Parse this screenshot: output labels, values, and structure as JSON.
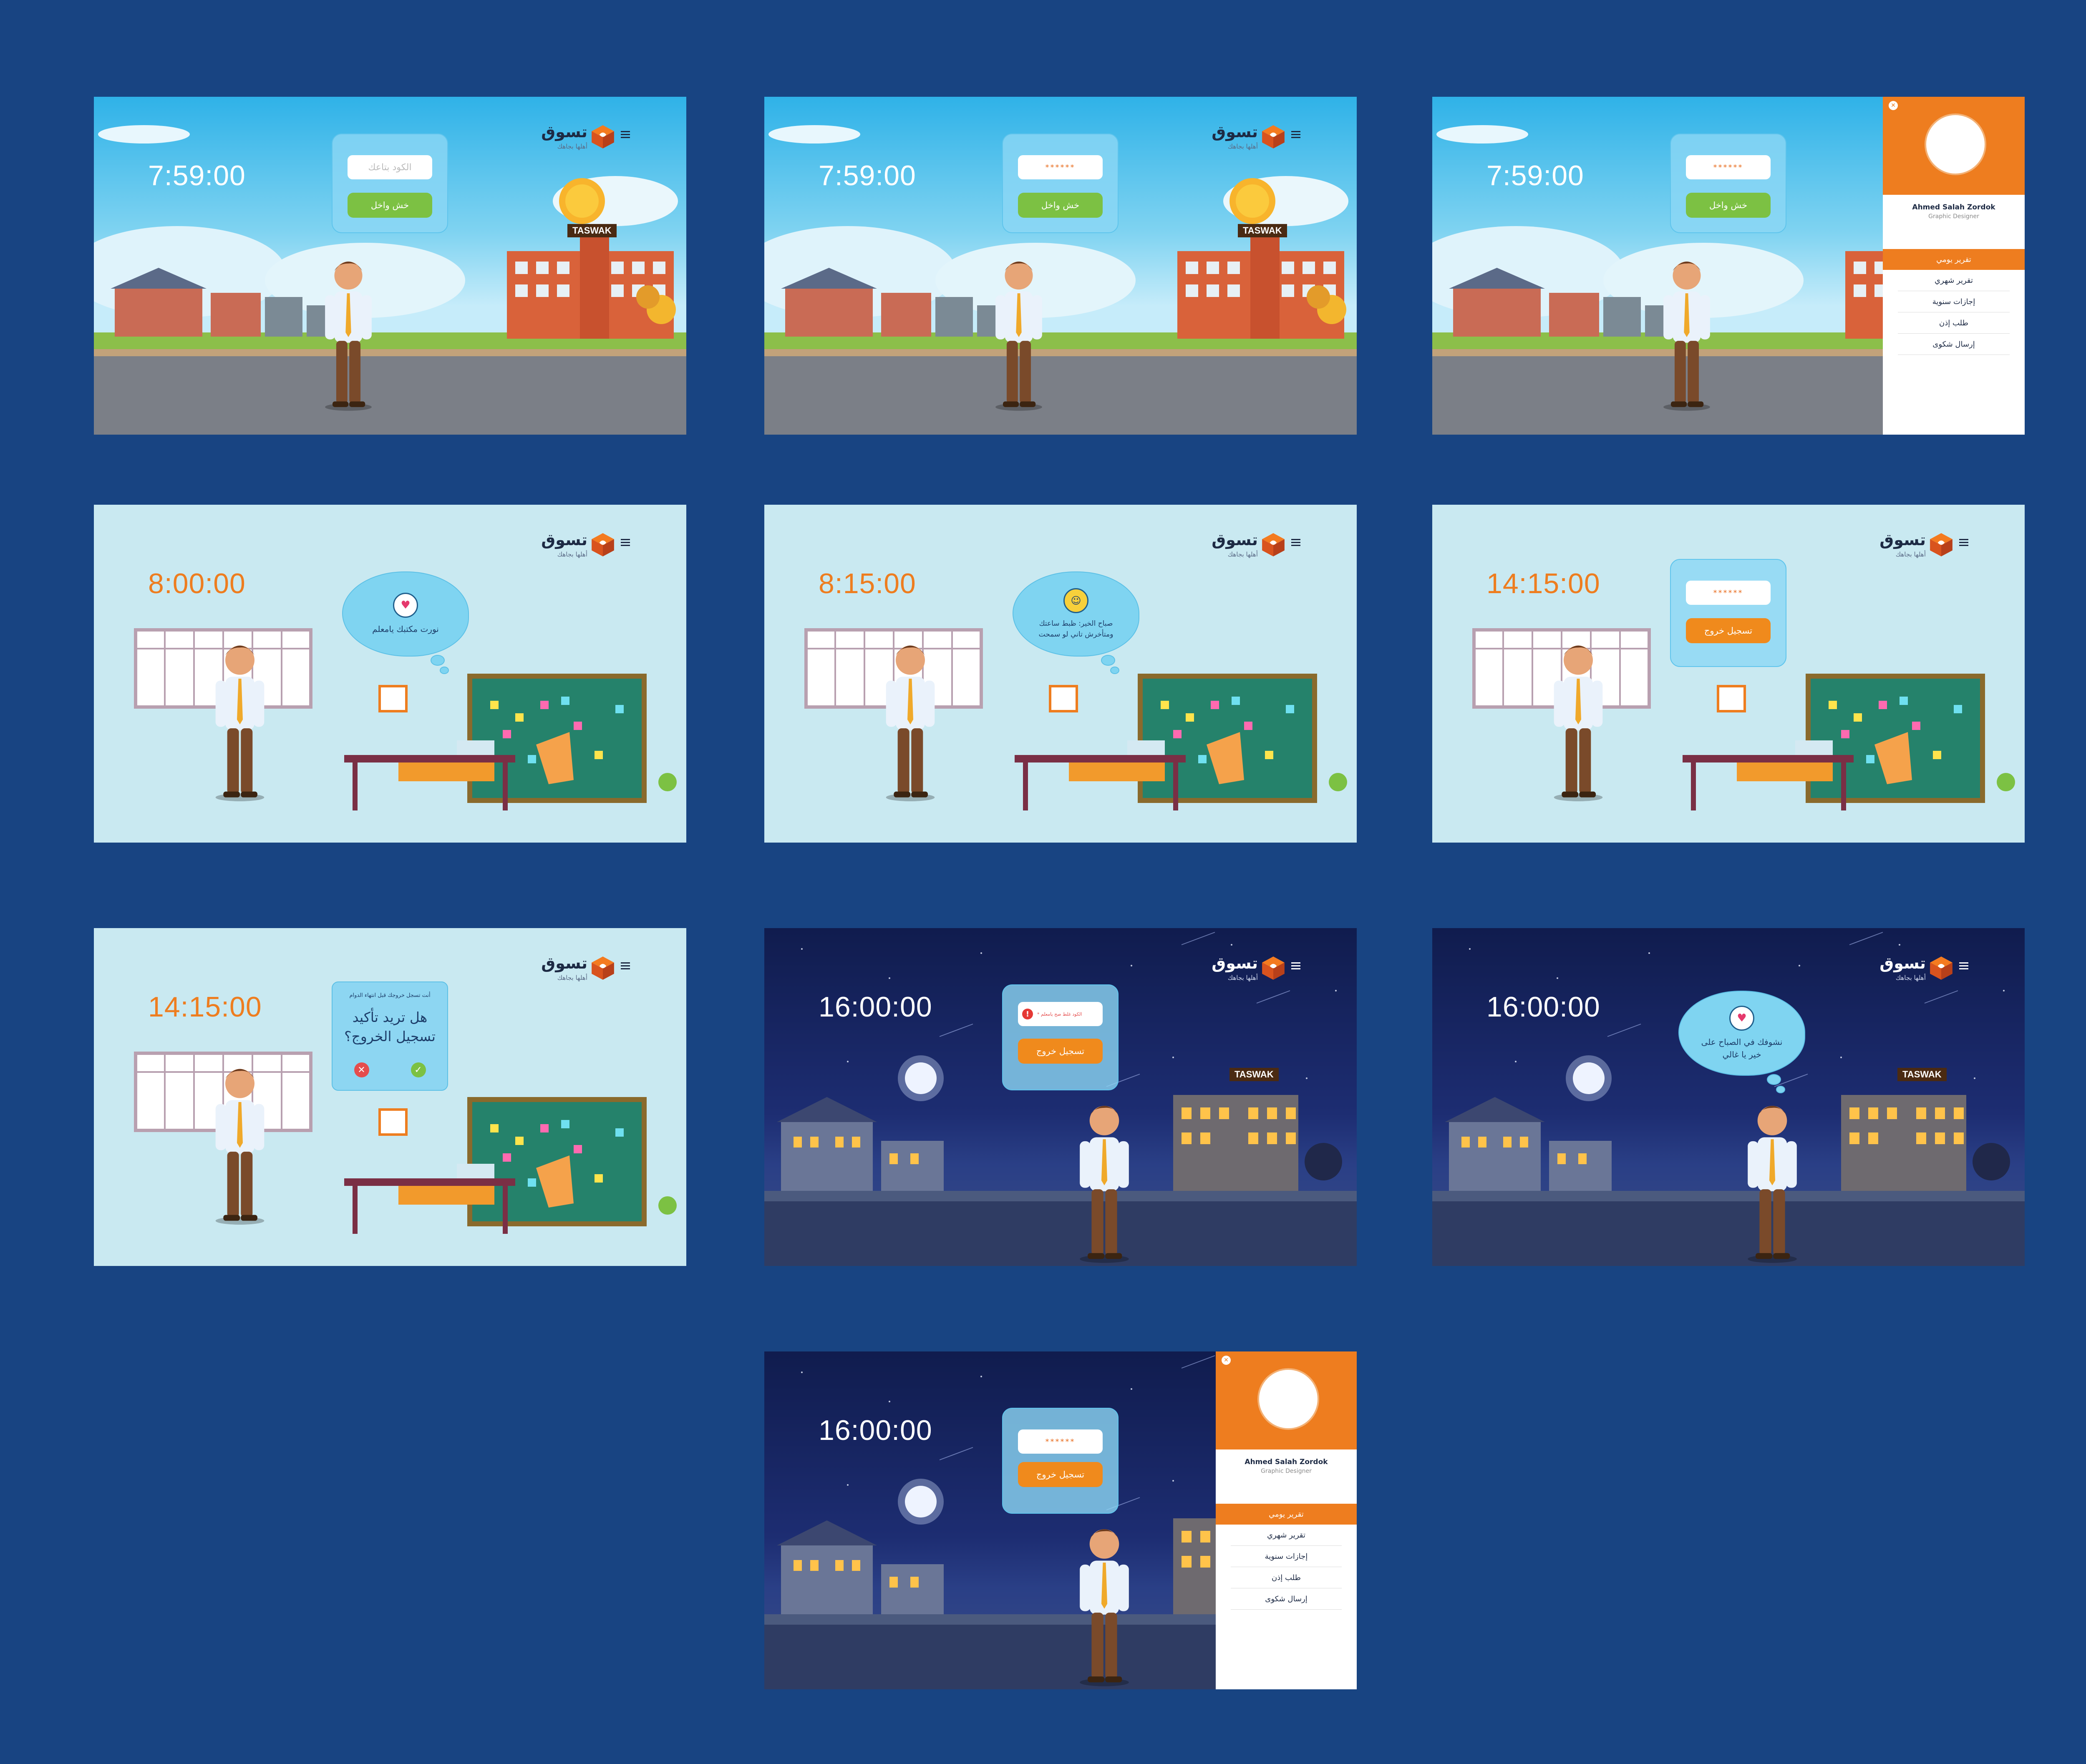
{
  "brand": {
    "name": "تسوق",
    "tagline": "أهلها بجاهك",
    "accent": "#ee7d1f",
    "building_sign": "TASWAK"
  },
  "colors": {
    "background": "#184482",
    "green_button": "#7cc143",
    "orange_button": "#f08a1c"
  },
  "screens": [
    {
      "time": "7:59:00",
      "code_placeholder": "الكود بتاعك",
      "enter_label": "خش واخل"
    },
    {
      "time": "7:59:00",
      "password_mask": "******",
      "enter_label": "خش واخل"
    },
    {
      "time": "7:59:00",
      "password_mask": "******",
      "enter_label": "خش واخل"
    },
    {
      "time": "8:00:00",
      "message": "نورت مكتبك يامعلم"
    },
    {
      "time": "8:15:00",
      "message": "صباح الخير: ظبط ساعتك ومتأخرش تاني لو سمحت"
    },
    {
      "time": "14:15:00",
      "password_mask": "******",
      "exit_label": "تسجيل خروج"
    },
    {
      "time": "14:15:00",
      "small": "أنت تسجل خروجك قبل انتهاء الدوام",
      "question": "هل تريد تأكيد تسجيل الخروج؟"
    },
    {
      "time": "16:00:00",
      "error": "* الكود غلط صح يامعلم",
      "exit_label": "تسجيل خروج"
    },
    {
      "time": "16:00:00",
      "message": "نشوفك في الصباح على خير يا غالي"
    },
    {
      "time": "16:00:00",
      "password_mask": "******",
      "exit_label": "تسجيل خروج"
    }
  ],
  "drawer": {
    "profile_name": "Ahmed Salah Zordok",
    "profile_role": "Graphic Designer",
    "close_icon": "close-icon",
    "items": [
      "تقرير يومي",
      "تقرير شهري",
      "إجازات سنوية",
      "طلب إذن",
      "إرسال شكوى"
    ]
  }
}
